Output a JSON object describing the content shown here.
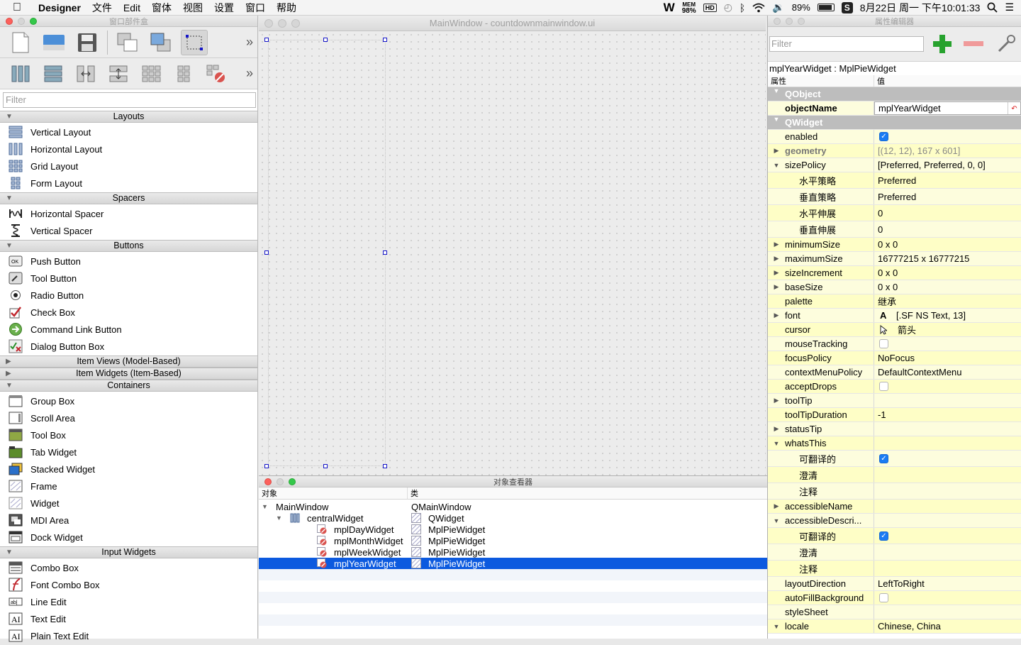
{
  "menubar": {
    "app": "Designer",
    "items": [
      "文件",
      "Edit",
      "窗体",
      "视图",
      "设置",
      "窗口",
      "帮助"
    ],
    "mem_label": "MEM",
    "mem_value": "98%",
    "hd": "HD",
    "battery": "89%",
    "clock": "8月22日 周一 下午10:01:33"
  },
  "widgetbox": {
    "title": "窗口部件盒",
    "filter_placeholder": "Filter",
    "categories": [
      {
        "name": "Layouts",
        "items": [
          "Vertical Layout",
          "Horizontal Layout",
          "Grid Layout",
          "Form Layout"
        ]
      },
      {
        "name": "Spacers",
        "items": [
          "Horizontal Spacer",
          "Vertical Spacer"
        ]
      },
      {
        "name": "Buttons",
        "items": [
          "Push Button",
          "Tool Button",
          "Radio Button",
          "Check Box",
          "Command Link Button",
          "Dialog Button Box"
        ]
      },
      {
        "name": "Item Views (Model-Based)",
        "items": []
      },
      {
        "name": "Item Widgets (Item-Based)",
        "items": []
      },
      {
        "name": "Containers",
        "items": [
          "Group Box",
          "Scroll Area",
          "Tool Box",
          "Tab Widget",
          "Stacked Widget",
          "Frame",
          "Widget",
          "MDI Area",
          "Dock Widget"
        ]
      },
      {
        "name": "Input Widgets",
        "items": [
          "Combo Box",
          "Font Combo Box",
          "Line Edit",
          "Text Edit",
          "Plain Text Edit"
        ]
      }
    ]
  },
  "form": {
    "title": "MainWindow - countdownmainwindow.ui"
  },
  "inspector": {
    "title": "对象查看器",
    "col_object": "对象",
    "col_class": "类",
    "rows": [
      {
        "name": "MainWindow",
        "cls": "QMainWindow"
      },
      {
        "name": "centralWidget",
        "cls": "QWidget"
      },
      {
        "name": "mplDayWidget",
        "cls": "MplPieWidget"
      },
      {
        "name": "mplMonthWidget",
        "cls": "MplPieWidget"
      },
      {
        "name": "mplWeekWidget",
        "cls": "MplPieWidget"
      },
      {
        "name": "mplYearWidget",
        "cls": "MplPieWidget"
      }
    ]
  },
  "props": {
    "title": "属性编辑器",
    "filter_placeholder": "Filter",
    "class_line": "mplYearWidget : MplPieWidget",
    "col_prop": "属性",
    "col_value": "值",
    "rows": [
      {
        "n": "QObject",
        "v": "",
        "t": "g"
      },
      {
        "n": "objectName",
        "v": "mplYearWidget",
        "t": "b"
      },
      {
        "n": "QWidget",
        "v": "",
        "t": "g"
      },
      {
        "n": "enabled",
        "v": "",
        "t": "chk_on"
      },
      {
        "n": "geometry",
        "v": "[(12, 12), 167 x 601]",
        "t": "bold_gray"
      },
      {
        "n": "sizePolicy",
        "v": "[Preferred, Preferred, 0, 0]",
        "t": "open"
      },
      {
        "n": "水平策略",
        "v": "Preferred",
        "t": "sub"
      },
      {
        "n": "垂直策略",
        "v": "Preferred",
        "t": "sub"
      },
      {
        "n": "水平伸展",
        "v": "0",
        "t": "sub"
      },
      {
        "n": "垂直伸展",
        "v": "0",
        "t": "sub"
      },
      {
        "n": "minimumSize",
        "v": "0 x 0",
        "t": "closed"
      },
      {
        "n": "maximumSize",
        "v": "16777215 x 16777215",
        "t": "closed"
      },
      {
        "n": "sizeIncrement",
        "v": "0 x 0",
        "t": "closed"
      },
      {
        "n": "baseSize",
        "v": "0 x 0",
        "t": "closed"
      },
      {
        "n": "palette",
        "v": "继承",
        "t": "plain"
      },
      {
        "n": "font",
        "v": "[.SF NS Text, 13]",
        "t": "closed_font"
      },
      {
        "n": "cursor",
        "v": "箭头",
        "t": "cursor"
      },
      {
        "n": "mouseTracking",
        "v": "",
        "t": "chk_off"
      },
      {
        "n": "focusPolicy",
        "v": "NoFocus",
        "t": "plain"
      },
      {
        "n": "contextMenuPolicy",
        "v": "DefaultContextMenu",
        "t": "plain"
      },
      {
        "n": "acceptDrops",
        "v": "",
        "t": "chk_off"
      },
      {
        "n": "toolTip",
        "v": "",
        "t": "closed"
      },
      {
        "n": "toolTipDuration",
        "v": "-1",
        "t": "plain"
      },
      {
        "n": "statusTip",
        "v": "",
        "t": "closed"
      },
      {
        "n": "whatsThis",
        "v": "",
        "t": "open"
      },
      {
        "n": "可翻译的",
        "v": "",
        "t": "sub_chk"
      },
      {
        "n": "澄清",
        "v": "",
        "t": "sub"
      },
      {
        "n": "注释",
        "v": "",
        "t": "sub"
      },
      {
        "n": "accessibleName",
        "v": "",
        "t": "closed"
      },
      {
        "n": "accessibleDescri...",
        "v": "",
        "t": "open"
      },
      {
        "n": "可翻译的",
        "v": "",
        "t": "sub_chk"
      },
      {
        "n": "澄清",
        "v": "",
        "t": "sub"
      },
      {
        "n": "注释",
        "v": "",
        "t": "sub"
      },
      {
        "n": "layoutDirection",
        "v": "LeftToRight",
        "t": "plain"
      },
      {
        "n": "autoFillBackground",
        "v": "",
        "t": "chk_off"
      },
      {
        "n": "styleSheet",
        "v": "",
        "t": "plain"
      },
      {
        "n": "locale",
        "v": "Chinese, China",
        "t": "open"
      }
    ]
  }
}
